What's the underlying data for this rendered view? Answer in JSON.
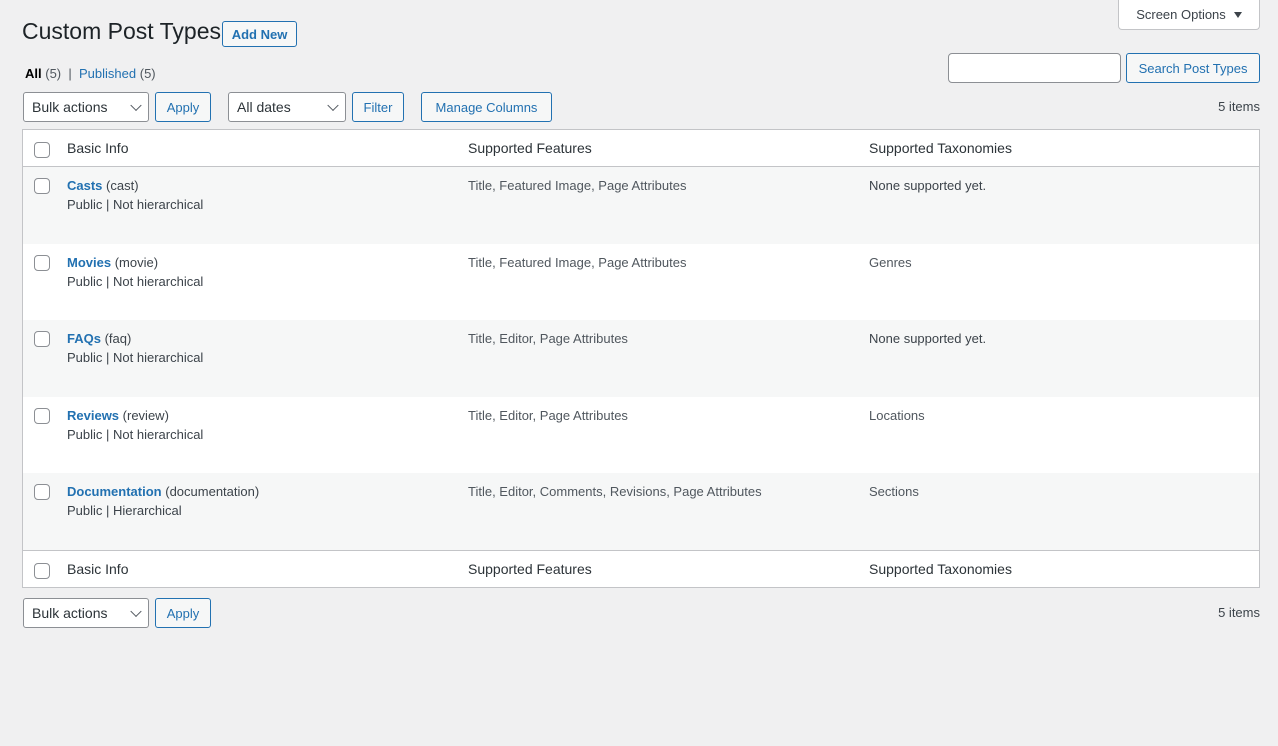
{
  "header": {
    "title": "Custom Post Types",
    "add_new_label": "Add New",
    "screen_options_label": "Screen Options"
  },
  "views": {
    "all_label": "All",
    "all_count": "(5)",
    "separator": "|",
    "published_label": "Published",
    "published_count": "(5)"
  },
  "search": {
    "value": "",
    "button_label": "Search Post Types"
  },
  "top_nav": {
    "bulk_actions_selected": "Bulk actions",
    "apply_label": "Apply",
    "dates_selected": "All dates",
    "filter_label": "Filter",
    "manage_columns_label": "Manage Columns",
    "items_count": "5 items"
  },
  "bottom_nav": {
    "bulk_actions_selected": "Bulk actions",
    "apply_label": "Apply",
    "items_count": "5 items"
  },
  "table": {
    "columns": [
      "Basic Info",
      "Supported Features",
      "Supported Taxonomies"
    ],
    "rows": [
      {
        "name": "Casts",
        "slug": "(cast)",
        "meta": "Public | Not hierarchical",
        "features": "Title, Featured Image, Page Attributes",
        "taxonomies": "None supported yet.",
        "tax_link": false
      },
      {
        "name": "Movies",
        "slug": "(movie)",
        "meta": "Public | Not hierarchical",
        "features": "Title, Featured Image, Page Attributes",
        "taxonomies": "Genres",
        "tax_link": true
      },
      {
        "name": "FAQs",
        "slug": "(faq)",
        "meta": "Public | Not hierarchical",
        "features": "Title, Editor, Page Attributes",
        "taxonomies": "None supported yet.",
        "tax_link": false
      },
      {
        "name": "Reviews",
        "slug": "(review)",
        "meta": "Public | Not hierarchical",
        "features": "Title, Editor, Page Attributes",
        "taxonomies": "Locations",
        "tax_link": true
      },
      {
        "name": "Documentation",
        "slug": "(documentation)",
        "meta": "Public | Hierarchical",
        "features": "Title, Editor, Comments, Revisions, Page Attributes",
        "taxonomies": "Sections",
        "tax_link": true
      }
    ]
  },
  "colors": {
    "accent": "#2271b1",
    "background": "#f0f0f1",
    "alt_row": "#f6f7f7",
    "border": "#c3c4c7"
  }
}
